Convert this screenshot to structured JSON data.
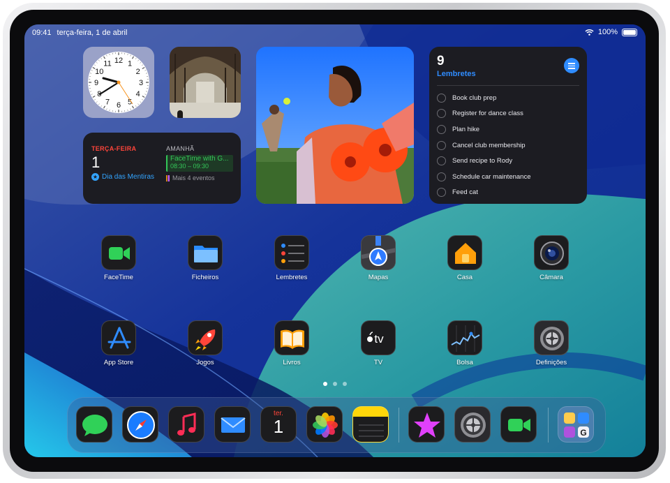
{
  "status": {
    "time": "09:41",
    "date": "terça-feira, 1 de abril",
    "battery": "100%"
  },
  "clock_widget": {
    "numerals": [
      "12",
      "1",
      "2",
      "3",
      "4",
      "5",
      "6",
      "7",
      "8",
      "9",
      "10",
      "11"
    ],
    "time_shown": "09:41"
  },
  "calendar_widget": {
    "today_label": "TERÇA-FEIRA",
    "today_number": "1",
    "holiday": "Dia das Mentiras",
    "tomorrow_label": "AMANHÃ",
    "event_title": "FaceTime with G...",
    "event_time": "08:30 – 09:30",
    "more": "Mais 4 eventos"
  },
  "reminders_widget": {
    "count": "9",
    "title": "Lembretes",
    "items": [
      "Book club prep",
      "Register for dance class",
      "Plan hike",
      "Cancel club membership",
      "Send recipe to Rody",
      "Schedule car maintenance",
      "Feed cat"
    ]
  },
  "apps": {
    "facetime": "FaceTime",
    "files": "Ficheiros",
    "reminders": "Lembretes",
    "maps": "Mapas",
    "home": "Casa",
    "camera": "Câmara",
    "appstore": "App Store",
    "games": "Jogos",
    "books": "Livros",
    "tv": "TV",
    "stocks": "Bolsa",
    "settings": "Definições"
  },
  "dock": {
    "calendar_day": "ter.",
    "calendar_number": "1",
    "apps": [
      "Mensagens",
      "Safari",
      "Música",
      "Mail",
      "Calendário",
      "Fotografias",
      "Notas",
      "iTunes Store",
      "Definições",
      "FaceTime",
      "Pasta de apps"
    ]
  },
  "page_dots": {
    "count": 3,
    "current": 1
  },
  "colors": {
    "accent_blue": "#2f8cff",
    "red": "#ff453a",
    "green": "#34c759",
    "wall_blue": "#12308f",
    "wall_teal": "#2ea7a8"
  }
}
